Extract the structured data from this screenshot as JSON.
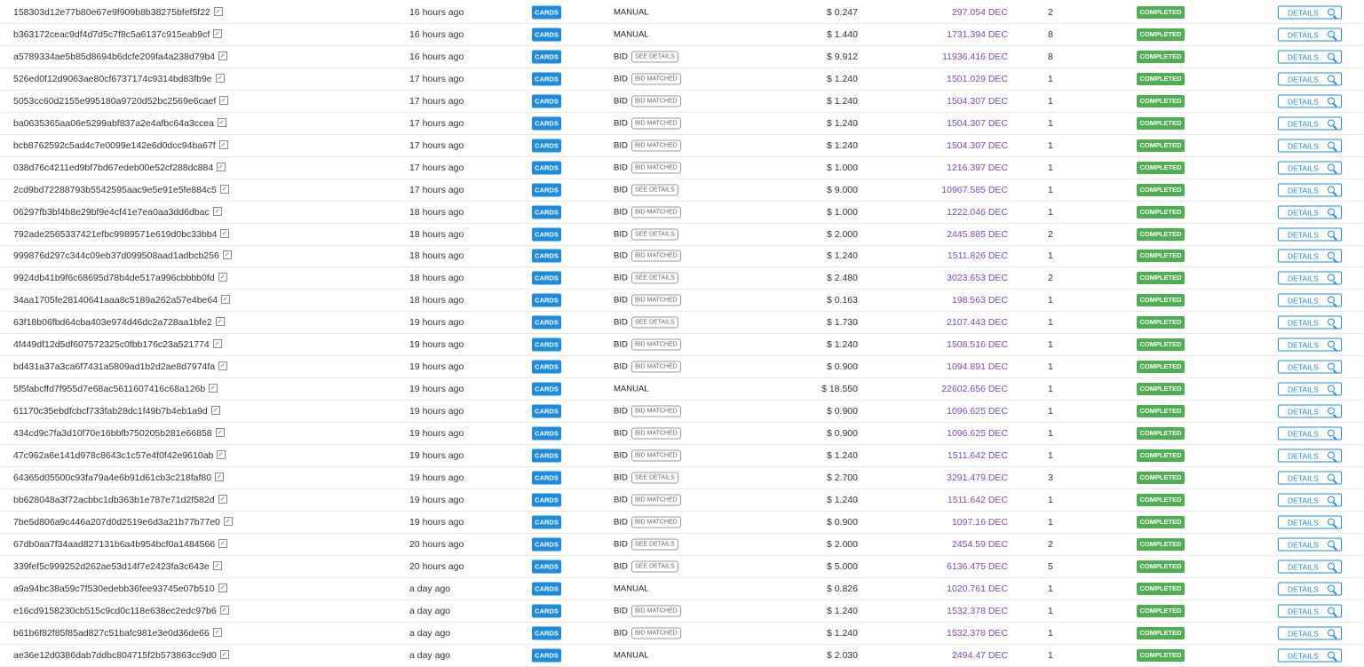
{
  "colors": {
    "cards_badge": "#1d8ce0",
    "completed_badge": "#4caf50",
    "dec_amount": "#7b4bb7",
    "details_button": "#1d8ce0"
  },
  "icons": {
    "external_link": "external-link-icon",
    "details": "search-icon"
  },
  "rows": [
    {
      "id": "158303d12e77b80e67e9f909b8b38275bfef5f22",
      "time": "16 hours ago",
      "type": "CARDS",
      "mode": "MANUAL",
      "tag": "",
      "price": "$ 0.247",
      "dec": "297.054 DEC",
      "qty": "2",
      "status": "COMPLETED",
      "action": "DETAILS"
    },
    {
      "id": "b363172ceac9df4d7d5c7f8c5a6137c915eab9cf",
      "time": "16 hours ago",
      "type": "CARDS",
      "mode": "MANUAL",
      "tag": "",
      "price": "$ 1.440",
      "dec": "1731.394 DEC",
      "qty": "8",
      "status": "COMPLETED",
      "action": "DETAILS"
    },
    {
      "id": "a5789334ae5b85d8694b6dcfe209fa4a238d79b4",
      "time": "16 hours ago",
      "type": "CARDS",
      "mode": "BID",
      "tag": "SEE DETAILS",
      "price": "$ 9.912",
      "dec": "11936.416 DEC",
      "qty": "8",
      "status": "COMPLETED",
      "action": "DETAILS"
    },
    {
      "id": "526ed0f12d9063ae80cf6737174c9314bd83fb9e",
      "time": "17 hours ago",
      "type": "CARDS",
      "mode": "BID",
      "tag": "BID MATCHED",
      "price": "$ 1.240",
      "dec": "1501.029 DEC",
      "qty": "1",
      "status": "COMPLETED",
      "action": "DETAILS"
    },
    {
      "id": "5053cc60d2155e995180a9720d52bc2569e6caef",
      "time": "17 hours ago",
      "type": "CARDS",
      "mode": "BID",
      "tag": "BID MATCHED",
      "price": "$ 1.240",
      "dec": "1504.307 DEC",
      "qty": "1",
      "status": "COMPLETED",
      "action": "DETAILS"
    },
    {
      "id": "ba0635365aa06e5299abf837a2e4afbc64a3ccea",
      "time": "17 hours ago",
      "type": "CARDS",
      "mode": "BID",
      "tag": "BID MATCHED",
      "price": "$ 1.240",
      "dec": "1504.307 DEC",
      "qty": "1",
      "status": "COMPLETED",
      "action": "DETAILS"
    },
    {
      "id": "bcb8762592c5ad4c7e0099e142e6d0dcc94ba67f",
      "time": "17 hours ago",
      "type": "CARDS",
      "mode": "BID",
      "tag": "BID MATCHED",
      "price": "$ 1.240",
      "dec": "1504.307 DEC",
      "qty": "1",
      "status": "COMPLETED",
      "action": "DETAILS"
    },
    {
      "id": "038d76c4211ed9bf7bd67edeb00e52cf288dc884",
      "time": "17 hours ago",
      "type": "CARDS",
      "mode": "BID",
      "tag": "BID MATCHED",
      "price": "$ 1.000",
      "dec": "1216.397 DEC",
      "qty": "1",
      "status": "COMPLETED",
      "action": "DETAILS"
    },
    {
      "id": "2cd9bd72288793b5542595aac9e5e91e5fe884c5",
      "time": "17 hours ago",
      "type": "CARDS",
      "mode": "BID",
      "tag": "SEE DETAILS",
      "price": "$ 9.000",
      "dec": "10967.585 DEC",
      "qty": "1",
      "status": "COMPLETED",
      "action": "DETAILS"
    },
    {
      "id": "06297fb3bf4b8e29bf9e4cf41e7ea0aa3dd6dbac",
      "time": "18 hours ago",
      "type": "CARDS",
      "mode": "BID",
      "tag": "BID MATCHED",
      "price": "$ 1.000",
      "dec": "1222.046 DEC",
      "qty": "1",
      "status": "COMPLETED",
      "action": "DETAILS"
    },
    {
      "id": "792ade2565337421efbc9989571e619d0bc33bb4",
      "time": "18 hours ago",
      "type": "CARDS",
      "mode": "BID",
      "tag": "SEE DETAILS",
      "price": "$ 2.000",
      "dec": "2445.885 DEC",
      "qty": "2",
      "status": "COMPLETED",
      "action": "DETAILS"
    },
    {
      "id": "999876d297c344c09eb37d099508aad1adbcb256",
      "time": "18 hours ago",
      "type": "CARDS",
      "mode": "BID",
      "tag": "BID MATCHED",
      "price": "$ 1.240",
      "dec": "1511.826 DEC",
      "qty": "1",
      "status": "COMPLETED",
      "action": "DETAILS"
    },
    {
      "id": "9924db41b9f6c68695d78b4de517a996cbbbb0fd",
      "time": "18 hours ago",
      "type": "CARDS",
      "mode": "BID",
      "tag": "SEE DETAILS",
      "price": "$ 2.480",
      "dec": "3023.653 DEC",
      "qty": "2",
      "status": "COMPLETED",
      "action": "DETAILS"
    },
    {
      "id": "34aa1705fe28140641aaa8c5189a262a57e4be64",
      "time": "18 hours ago",
      "type": "CARDS",
      "mode": "BID",
      "tag": "BID MATCHED",
      "price": "$ 0.163",
      "dec": "198.563 DEC",
      "qty": "1",
      "status": "COMPLETED",
      "action": "DETAILS"
    },
    {
      "id": "63f18b06fbd64cba403e974d46dc2a728aa1bfe2",
      "time": "19 hours ago",
      "type": "CARDS",
      "mode": "BID",
      "tag": "SEE DETAILS",
      "price": "$ 1.730",
      "dec": "2107.443 DEC",
      "qty": "1",
      "status": "COMPLETED",
      "action": "DETAILS"
    },
    {
      "id": "4f449df12d5df607572325c0fbb176c23a521774",
      "time": "19 hours ago",
      "type": "CARDS",
      "mode": "BID",
      "tag": "BID MATCHED",
      "price": "$ 1.240",
      "dec": "1508.516 DEC",
      "qty": "1",
      "status": "COMPLETED",
      "action": "DETAILS"
    },
    {
      "id": "bd431a37a3ca6f7431a5809ad1b2d2ae8d7974fa",
      "time": "19 hours ago",
      "type": "CARDS",
      "mode": "BID",
      "tag": "BID MATCHED",
      "price": "$ 0.900",
      "dec": "1094.891 DEC",
      "qty": "1",
      "status": "COMPLETED",
      "action": "DETAILS"
    },
    {
      "id": "5f5fabcffd7f955d7e68ac5611607416c68a126b",
      "time": "19 hours ago",
      "type": "CARDS",
      "mode": "MANUAL",
      "tag": "",
      "price": "$ 18.550",
      "dec": "22602.656 DEC",
      "qty": "1",
      "status": "COMPLETED",
      "action": "DETAILS"
    },
    {
      "id": "61170c35ebdfcbcf733fab28dc1f49b7b4eb1a9d",
      "time": "19 hours ago",
      "type": "CARDS",
      "mode": "BID",
      "tag": "BID MATCHED",
      "price": "$ 0.900",
      "dec": "1096.625 DEC",
      "qty": "1",
      "status": "COMPLETED",
      "action": "DETAILS"
    },
    {
      "id": "434cd9c7fa3d10f70e16bbfb750205b281e66858",
      "time": "19 hours ago",
      "type": "CARDS",
      "mode": "BID",
      "tag": "BID MATCHED",
      "price": "$ 0.900",
      "dec": "1096.625 DEC",
      "qty": "1",
      "status": "COMPLETED",
      "action": "DETAILS"
    },
    {
      "id": "47c962a6e141d978c8643c1c57e4f0f42e9610ab",
      "time": "19 hours ago",
      "type": "CARDS",
      "mode": "BID",
      "tag": "BID MATCHED",
      "price": "$ 1.240",
      "dec": "1511.642 DEC",
      "qty": "1",
      "status": "COMPLETED",
      "action": "DETAILS"
    },
    {
      "id": "64365d05500c93fa79a4e6b91d61cb3c218faf80",
      "time": "19 hours ago",
      "type": "CARDS",
      "mode": "BID",
      "tag": "SEE DETAILS",
      "price": "$ 2.700",
      "dec": "3291.479 DEC",
      "qty": "3",
      "status": "COMPLETED",
      "action": "DETAILS"
    },
    {
      "id": "bb628048a3f72acbbc1db363b1e787e71d2f582d",
      "time": "19 hours ago",
      "type": "CARDS",
      "mode": "BID",
      "tag": "BID MATCHED",
      "price": "$ 1.240",
      "dec": "1511.642 DEC",
      "qty": "1",
      "status": "COMPLETED",
      "action": "DETAILS"
    },
    {
      "id": "7be5d806a9c446a207d0d2519e6d3a21b77b77e0",
      "time": "19 hours ago",
      "type": "CARDS",
      "mode": "BID",
      "tag": "BID MATCHED",
      "price": "$ 0.900",
      "dec": "1097.16 DEC",
      "qty": "1",
      "status": "COMPLETED",
      "action": "DETAILS"
    },
    {
      "id": "67db0aa7f34aad827131b6a4b954bcf0a1484566",
      "time": "20 hours ago",
      "type": "CARDS",
      "mode": "BID",
      "tag": "SEE DETAILS",
      "price": "$ 2.000",
      "dec": "2454.59 DEC",
      "qty": "2",
      "status": "COMPLETED",
      "action": "DETAILS"
    },
    {
      "id": "339fef5c999252d262ae53d14f7e2423fa3c643e",
      "time": "20 hours ago",
      "type": "CARDS",
      "mode": "BID",
      "tag": "SEE DETAILS",
      "price": "$ 5.000",
      "dec": "6136.475 DEC",
      "qty": "5",
      "status": "COMPLETED",
      "action": "DETAILS"
    },
    {
      "id": "a9a94bc38a59c7f530edebb36fee93745e07b510",
      "time": "a day ago",
      "type": "CARDS",
      "mode": "MANUAL",
      "tag": "",
      "price": "$ 0.826",
      "dec": "1020.761 DEC",
      "qty": "1",
      "status": "COMPLETED",
      "action": "DETAILS"
    },
    {
      "id": "e16cd9158230cb515c9cd0c118e638ec2edc97b6",
      "time": "a day ago",
      "type": "CARDS",
      "mode": "BID",
      "tag": "BID MATCHED",
      "price": "$ 1.240",
      "dec": "1532.378 DEC",
      "qty": "1",
      "status": "COMPLETED",
      "action": "DETAILS"
    },
    {
      "id": "b61b6f82f85f85ad827c51bafc981e3e0d36de66",
      "time": "a day ago",
      "type": "CARDS",
      "mode": "BID",
      "tag": "BID MATCHED",
      "price": "$ 1.240",
      "dec": "1532.378 DEC",
      "qty": "1",
      "status": "COMPLETED",
      "action": "DETAILS"
    },
    {
      "id": "ae36e12d0386dab7ddbc804715f2b573863cc9d0",
      "time": "a day ago",
      "type": "CARDS",
      "mode": "MANUAL",
      "tag": "",
      "price": "$ 2.030",
      "dec": "2494.47 DEC",
      "qty": "1",
      "status": "COMPLETED",
      "action": "DETAILS"
    }
  ]
}
